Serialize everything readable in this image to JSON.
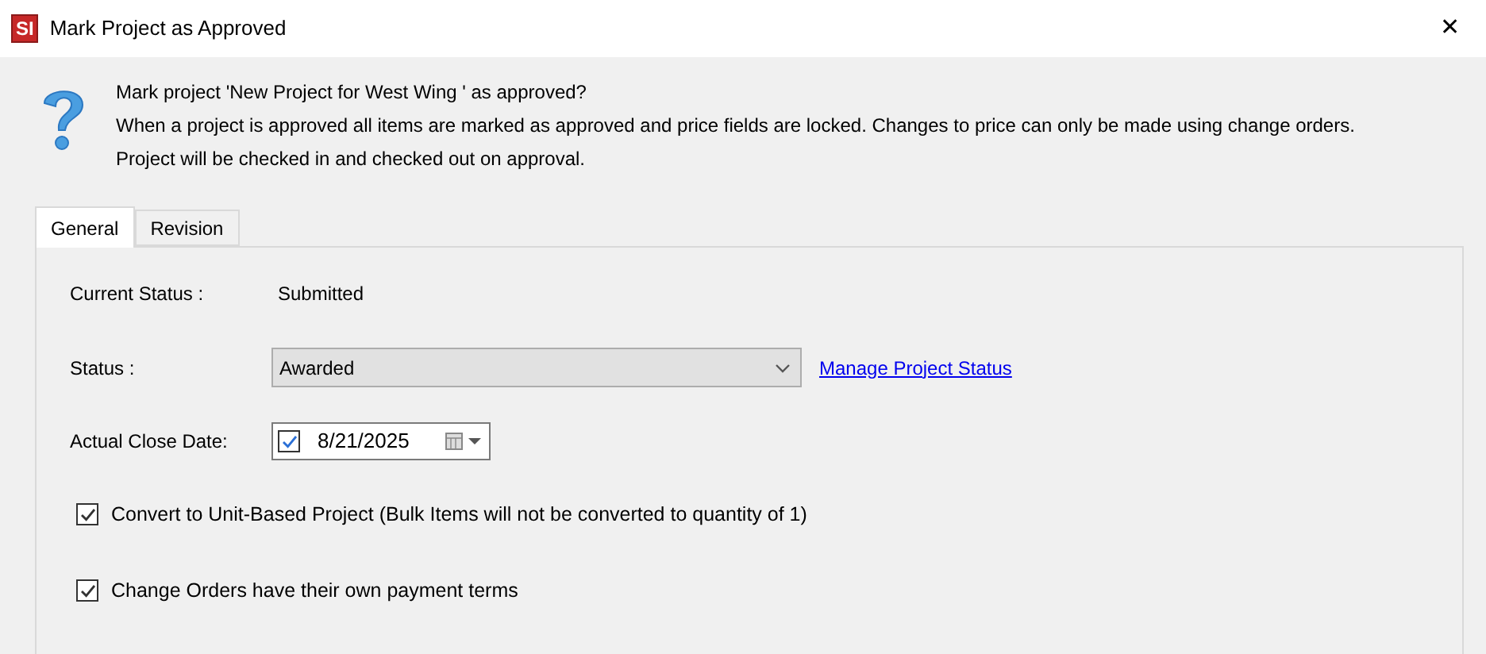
{
  "window": {
    "logo": "SI",
    "title": "Mark Project as Approved",
    "close": "✕"
  },
  "message": {
    "question": "Mark project 'New Project for West Wing ' as approved?",
    "lines": [
      "When a project is approved all items are marked as approved and price fields are locked. Changes to price can only be made using change orders.",
      "Project will be checked in and checked out on approval."
    ]
  },
  "tabs": [
    {
      "label": "General",
      "selected": true
    },
    {
      "label": "Revision",
      "selected": false
    }
  ],
  "form": {
    "current_status_label": "Current Status :",
    "current_status": "Submitted",
    "status_label": "Status :",
    "status_value": "Awarded",
    "manage_link": "Manage Project Status",
    "close_date_label": "Actual Close Date:",
    "close_date_checked": true,
    "close_date": "8/21/2025"
  },
  "options": [
    {
      "label": "Convert to Unit-Based Project (Bulk Items will not be converted to quantity of 1)",
      "checked": true
    },
    {
      "label": "Change Orders have their own payment terms",
      "checked": true
    }
  ]
}
